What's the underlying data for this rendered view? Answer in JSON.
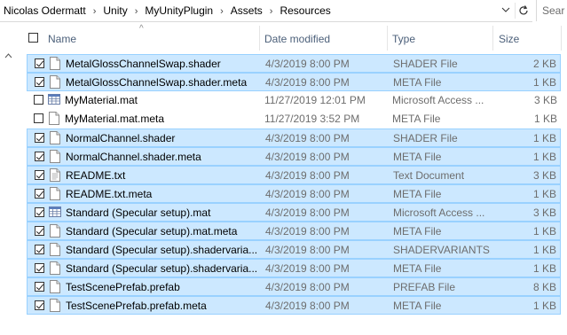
{
  "breadcrumb": [
    "Nicolas Odermatt",
    "Unity",
    "MyUnityPlugin",
    "Assets",
    "Resources"
  ],
  "search_placeholder": "Sear",
  "columns": {
    "name": "Name",
    "date": "Date modified",
    "type": "Type",
    "size": "Size"
  },
  "files": [
    {
      "name": "MetalGlossChannelSwap.shader",
      "date": "4/3/2019 8:00 PM",
      "type": "SHADER File",
      "size": "2 KB",
      "selected": true,
      "icon": "file-icon"
    },
    {
      "name": "MetalGlossChannelSwap.shader.meta",
      "date": "4/3/2019 8:00 PM",
      "type": "META File",
      "size": "1 KB",
      "selected": true,
      "icon": "file-icon"
    },
    {
      "name": "MyMaterial.mat",
      "date": "11/27/2019 12:01 PM",
      "type": "Microsoft Access ...",
      "size": "3 KB",
      "selected": false,
      "icon": "table-file-icon"
    },
    {
      "name": "MyMaterial.mat.meta",
      "date": "11/27/2019 3:52 PM",
      "type": "META File",
      "size": "1 KB",
      "selected": false,
      "icon": "file-icon"
    },
    {
      "name": "NormalChannel.shader",
      "date": "4/3/2019 8:00 PM",
      "type": "SHADER File",
      "size": "1 KB",
      "selected": true,
      "icon": "file-icon"
    },
    {
      "name": "NormalChannel.shader.meta",
      "date": "4/3/2019 8:00 PM",
      "type": "META File",
      "size": "1 KB",
      "selected": true,
      "icon": "file-icon"
    },
    {
      "name": "README.txt",
      "date": "4/3/2019 8:00 PM",
      "type": "Text Document",
      "size": "3 KB",
      "selected": true,
      "icon": "text-file-icon"
    },
    {
      "name": "README.txt.meta",
      "date": "4/3/2019 8:00 PM",
      "type": "META File",
      "size": "1 KB",
      "selected": true,
      "icon": "file-icon"
    },
    {
      "name": "Standard (Specular setup).mat",
      "date": "4/3/2019 8:00 PM",
      "type": "Microsoft Access ...",
      "size": "3 KB",
      "selected": true,
      "icon": "table-file-icon"
    },
    {
      "name": "Standard (Specular setup).mat.meta",
      "date": "4/3/2019 8:00 PM",
      "type": "META File",
      "size": "1 KB",
      "selected": true,
      "icon": "file-icon"
    },
    {
      "name": "Standard (Specular setup).shadervaria...",
      "date": "4/3/2019 8:00 PM",
      "type": "SHADERVARIANTS...",
      "size": "1 KB",
      "selected": true,
      "icon": "file-icon"
    },
    {
      "name": "Standard (Specular setup).shadervaria...",
      "date": "4/3/2019 8:00 PM",
      "type": "META File",
      "size": "1 KB",
      "selected": true,
      "icon": "file-icon"
    },
    {
      "name": "TestScenePrefab.prefab",
      "date": "4/3/2019 8:00 PM",
      "type": "PREFAB File",
      "size": "8 KB",
      "selected": true,
      "icon": "file-icon"
    },
    {
      "name": "TestScenePrefab.prefab.meta",
      "date": "4/3/2019 8:00 PM",
      "type": "META File",
      "size": "1 KB",
      "selected": true,
      "icon": "file-icon"
    }
  ]
}
